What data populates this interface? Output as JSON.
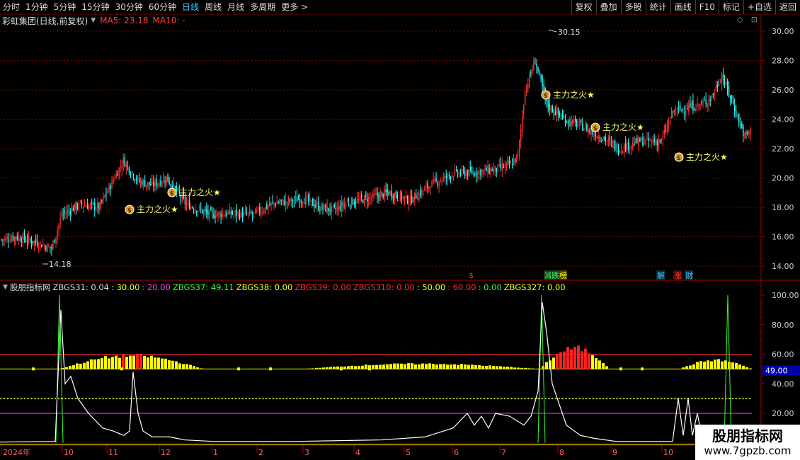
{
  "toolbar": {
    "periods": [
      "分时",
      "1分钟",
      "5分钟",
      "15分钟",
      "30分钟",
      "60分钟",
      "日线",
      "周线",
      "月线",
      "多周期",
      "更多 >"
    ],
    "active_index": 6,
    "right_buttons": [
      "复权",
      "叠加",
      "多股",
      "统计",
      "画线",
      "F10",
      "标记",
      "+自选",
      "返回"
    ]
  },
  "info": {
    "stock_name": "彩虹集团(日线,前复权)",
    "ma5": "MA5: 23.18",
    "ma10": "MA10: -",
    "icon_diamond": "diamond-icon",
    "icon_expand": "expand-icon"
  },
  "main_axis": {
    "labels": [
      "30.00",
      "28.00",
      "26.00",
      "24.00",
      "22.00",
      "20.00",
      "18.00",
      "16.00",
      "14.00"
    ],
    "values": [
      30,
      28,
      26,
      24,
      22,
      20,
      18,
      16,
      14
    ],
    "high_label": "30.15",
    "low_label": "14.18"
  },
  "signals": {
    "label": "主力之火",
    "star": "★",
    "icon": "money-bag-icon"
  },
  "event_tags": [
    {
      "text": "$",
      "color": "#ff3030",
      "bg": "transparent"
    },
    {
      "text": "减",
      "color": "#33ff66",
      "bg": "#1a3a1a"
    },
    {
      "text": "跌",
      "color": "#33ff66",
      "bg": "#1a3a1a"
    },
    {
      "text": "榜",
      "color": "#ffff00",
      "bg": "#3a3a00"
    },
    {
      "text": "解",
      "color": "#33ccff",
      "bg": "#0a2a3a"
    },
    {
      "text": "涨",
      "color": "#ff4040",
      "bg": "#3a0a0a"
    },
    {
      "text": "财",
      "color": "#33ccff",
      "bg": "#0a2a3a"
    }
  ],
  "indicator": {
    "name": "股朋指标网",
    "items": [
      {
        "text": "ZBGS31: 0.04",
        "color": "#dddddd"
      },
      {
        "text": ": 30.00",
        "color": "#ffff00"
      },
      {
        "text": ": 20.00",
        "color": "#ff40ff"
      },
      {
        "text": "ZBGS37: 49.11",
        "color": "#33ff33"
      },
      {
        "text": "ZBGS38: 0.00",
        "color": "#ffff00"
      },
      {
        "text": "ZBGS39: 0.00",
        "color": "#ff3030"
      },
      {
        "text": "ZBGS310: 0.00",
        "color": "#ff3030"
      },
      {
        "text": ": 50.00",
        "color": "#ffff00"
      },
      {
        "text": ": 60.00",
        "color": "#ff3030"
      },
      {
        "text": ": 0.00",
        "color": "#33ff33"
      },
      {
        "text": "ZBGS327: 0.00",
        "color": "#ffff00"
      }
    ],
    "axis_labels": [
      "100.00",
      "80.00",
      "60.00",
      "40.00",
      "20.00"
    ],
    "axis_values": [
      100,
      80,
      60,
      40,
      20
    ],
    "current_value": "49.00"
  },
  "time_axis": {
    "labels": [
      "2024年",
      "10",
      "11",
      "12",
      "1",
      "2",
      "3",
      "4",
      "5",
      "6",
      "7",
      "8",
      "9",
      "10"
    ]
  },
  "watermark": {
    "line1": "股朋指标网",
    "line2": "www.7gpzb.com"
  },
  "colors": {
    "up": "#ff3030",
    "down": "#33ffff",
    "yellow": "#ffff00",
    "green": "#33ff33",
    "grid": "#7a0000"
  }
}
